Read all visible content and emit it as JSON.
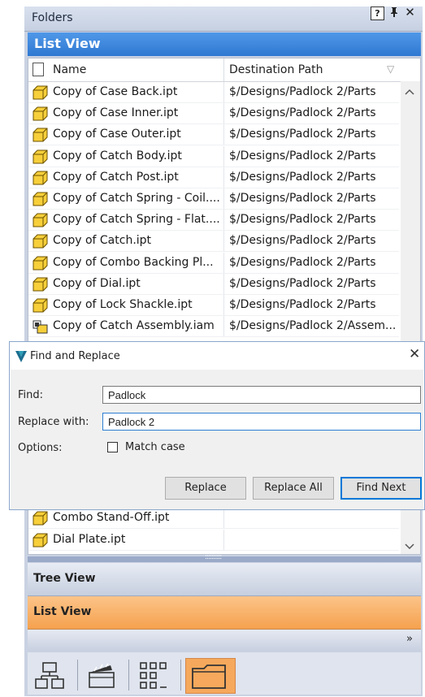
{
  "panel": {
    "title": "Folders",
    "help_glyph": "?",
    "pin_glyph": "⫫",
    "close_glyph": "✕"
  },
  "list_view": {
    "header": "List View",
    "columns": {
      "name": "Name",
      "path": "Destination Path"
    },
    "rows": [
      {
        "name": "Copy of Case Back.ipt",
        "path": "$/Designs/Padlock 2/Parts",
        "icon": "part-icon"
      },
      {
        "name": "Copy of Case Inner.ipt",
        "path": "$/Designs/Padlock 2/Parts",
        "icon": "part-icon"
      },
      {
        "name": "Copy of Case Outer.ipt",
        "path": "$/Designs/Padlock 2/Parts",
        "icon": "part-icon"
      },
      {
        "name": "Copy of Catch Body.ipt",
        "path": "$/Designs/Padlock 2/Parts",
        "icon": "part-icon"
      },
      {
        "name": "Copy of Catch Post.ipt",
        "path": "$/Designs/Padlock 2/Parts",
        "icon": "part-icon"
      },
      {
        "name": "Copy of Catch Spring - Coil....",
        "path": "$/Designs/Padlock 2/Parts",
        "icon": "part-icon"
      },
      {
        "name": "Copy of Catch Spring - Flat....",
        "path": "$/Designs/Padlock 2/Parts",
        "icon": "part-icon"
      },
      {
        "name": "Copy of Catch.ipt",
        "path": "$/Designs/Padlock 2/Parts",
        "icon": "part-icon"
      },
      {
        "name": "Copy of Combo Backing Pl...",
        "path": "$/Designs/Padlock 2/Parts",
        "icon": "part-icon"
      },
      {
        "name": "Copy of Dial.ipt",
        "path": "$/Designs/Padlock 2/Parts",
        "icon": "part-icon"
      },
      {
        "name": "Copy of Lock Shackle.ipt",
        "path": "$/Designs/Padlock 2/Parts",
        "icon": "part-icon"
      },
      {
        "name": "Copy of Catch Assembly.iam",
        "path": "$/Designs/Padlock 2/Assem...",
        "icon": "assembly-icon"
      }
    ],
    "lower_rows": [
      {
        "name": "Combo Stand-Off.ipt",
        "path": "",
        "icon": "part-icon"
      },
      {
        "name": "Dial Plate.ipt",
        "path": "",
        "icon": "part-icon"
      }
    ]
  },
  "tabs": {
    "tree_view": "Tree View",
    "list_view": "List View",
    "more_glyph": "»"
  },
  "dialog": {
    "title": "Find and Replace",
    "close_glyph": "✕",
    "find_label": "Find:",
    "find_value": "Padlock",
    "replace_label": "Replace with:",
    "replace_value": "Padlock 2",
    "options_label": "Options:",
    "match_case_label": "Match case",
    "match_case_checked": false,
    "buttons": {
      "replace": "Replace",
      "replace_all": "Replace All",
      "find_next": "Find Next"
    }
  },
  "colors": {
    "list_header": "#2f78d2",
    "active_tab": "#f5a14e",
    "part_icon": "#f7cf3a",
    "accent": "#0078d7"
  }
}
